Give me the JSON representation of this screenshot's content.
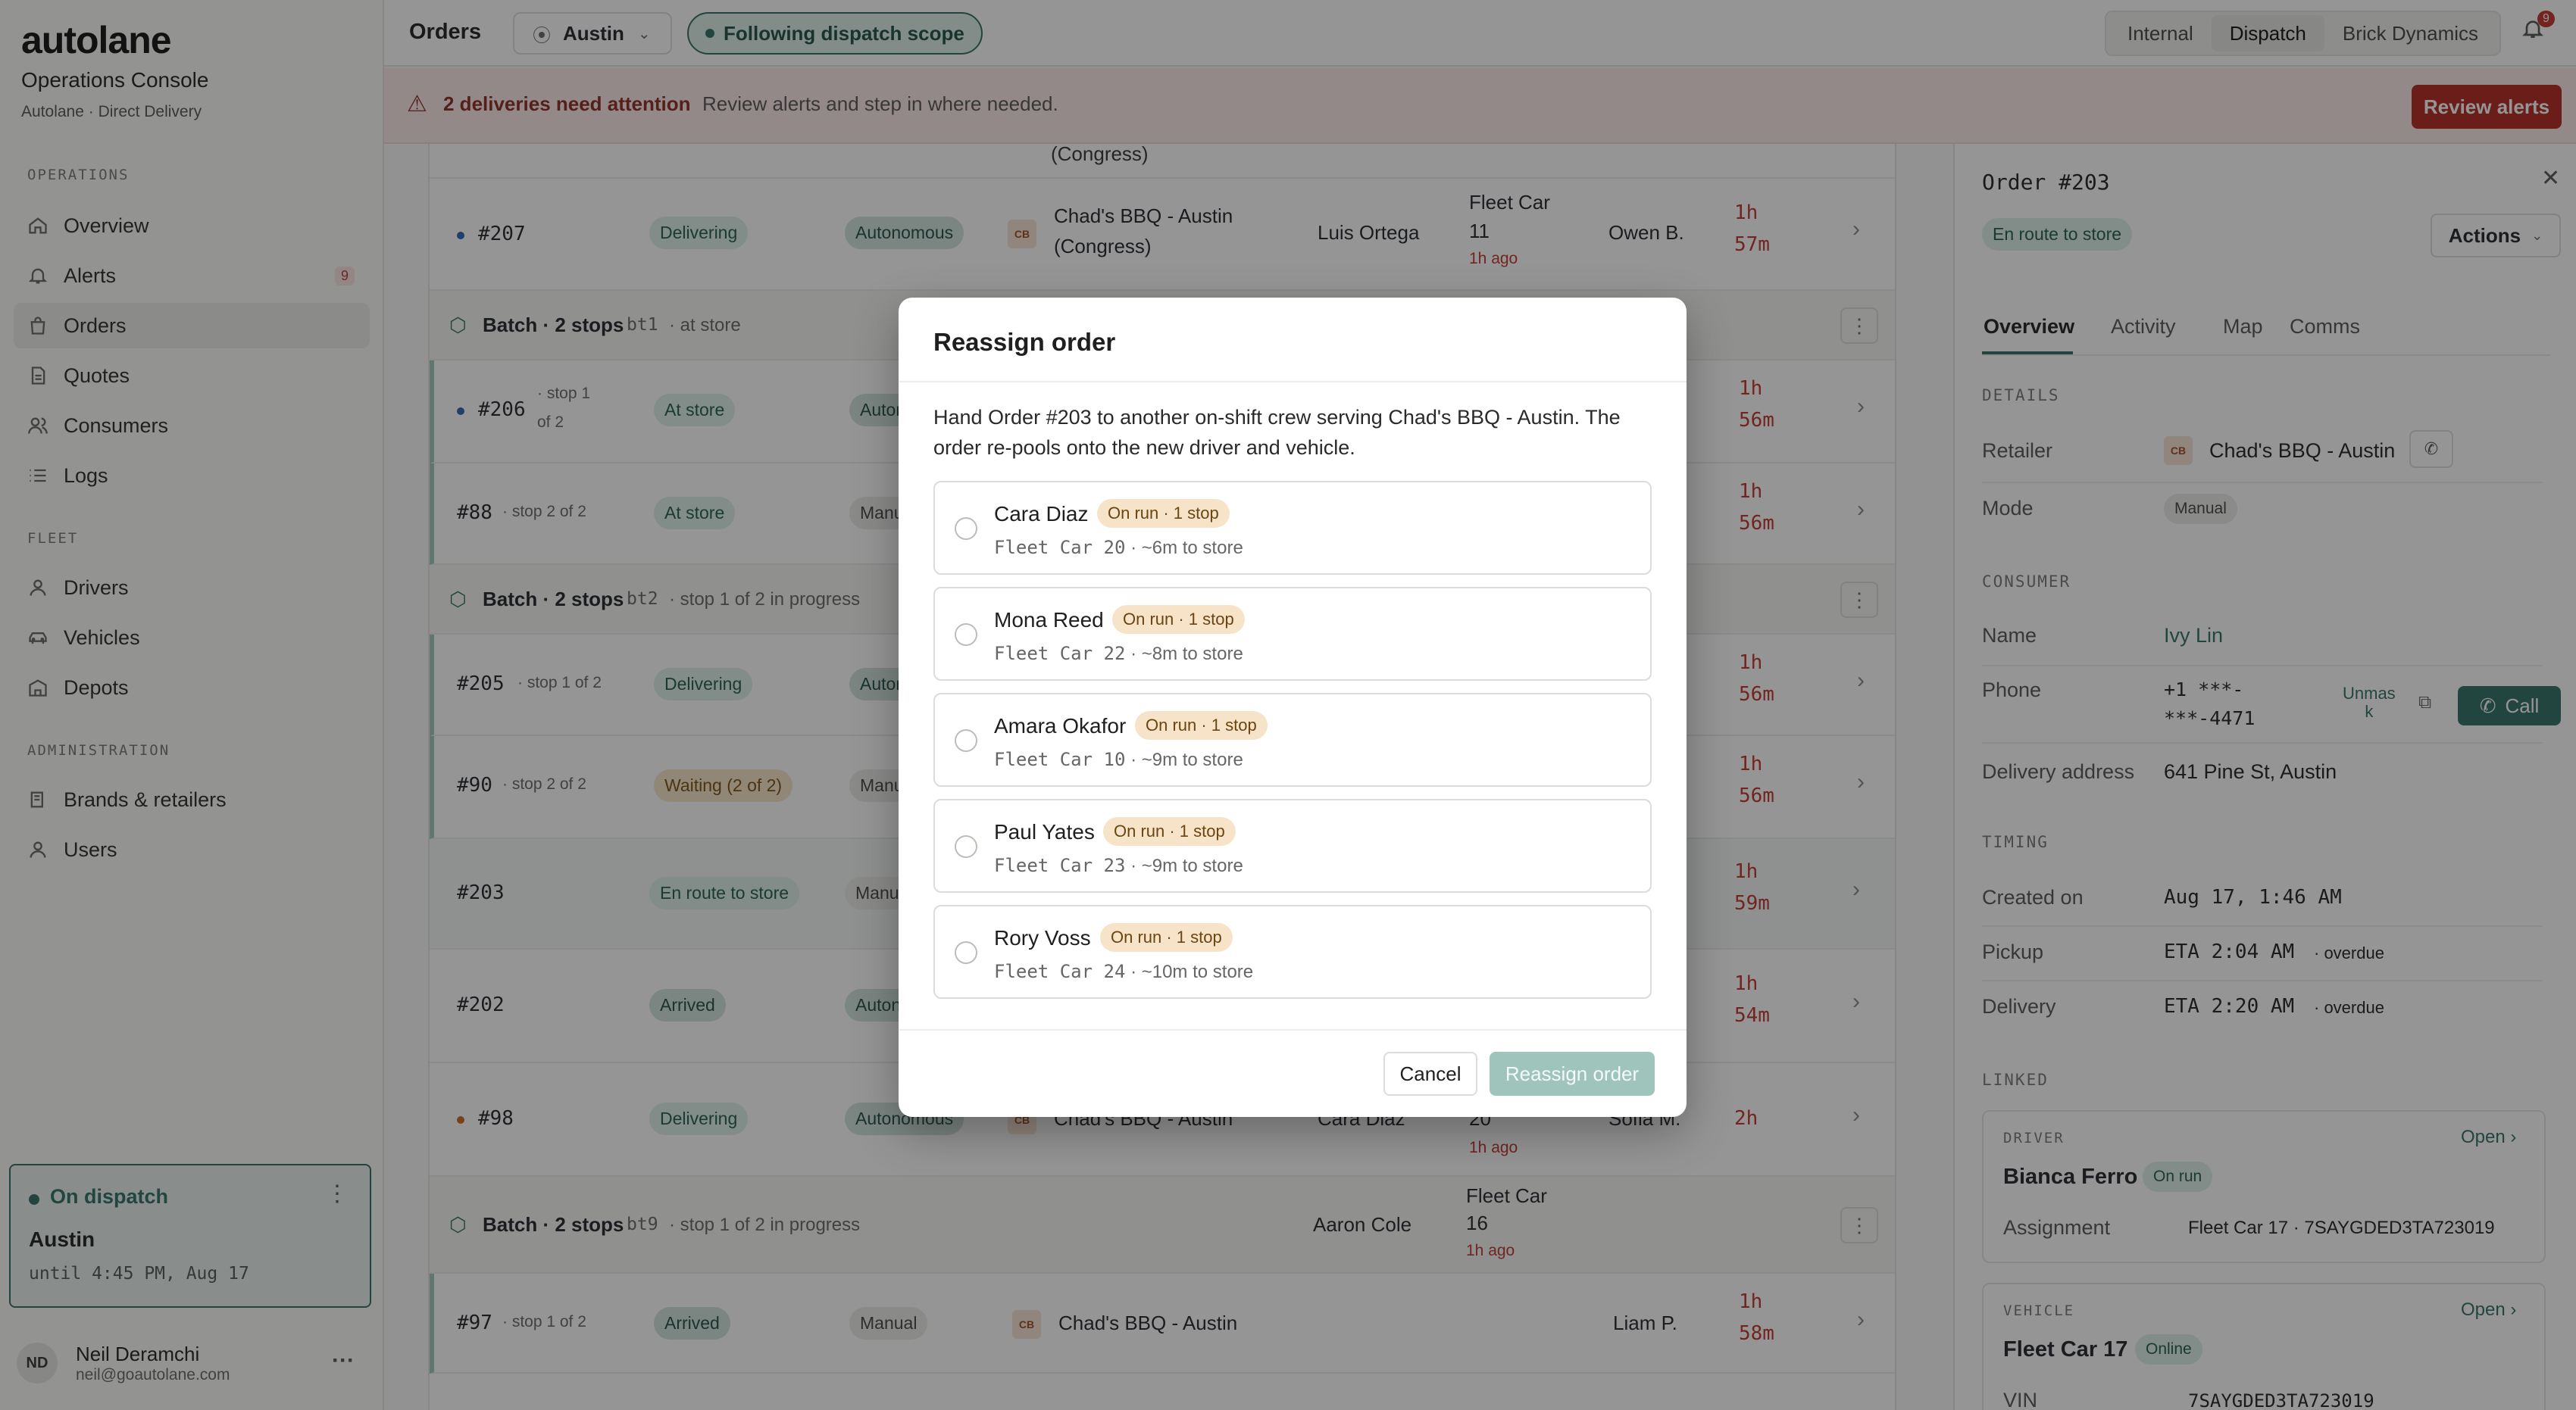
{
  "brand": {
    "logo": "autolane",
    "title": "Operations Console",
    "subtitle": "Autolane · Direct Delivery"
  },
  "sidebar": {
    "sections": [
      {
        "label": "OPERATIONS",
        "items": [
          {
            "label": "Overview",
            "icon": "home-icon"
          },
          {
            "label": "Alerts",
            "icon": "bell-icon",
            "badge": "9"
          },
          {
            "label": "Orders",
            "icon": "bag-icon",
            "active": true
          },
          {
            "label": "Quotes",
            "icon": "document-icon"
          },
          {
            "label": "Consumers",
            "icon": "users-icon"
          },
          {
            "label": "Logs",
            "icon": "list-icon"
          }
        ]
      },
      {
        "label": "FLEET",
        "items": [
          {
            "label": "Drivers",
            "icon": "person-icon"
          },
          {
            "label": "Vehicles",
            "icon": "car-icon"
          },
          {
            "label": "Depots",
            "icon": "building-icon"
          }
        ]
      },
      {
        "label": "ADMINISTRATION",
        "items": [
          {
            "label": "Brands & retailers",
            "icon": "book-icon"
          },
          {
            "label": "Users",
            "icon": "person-icon"
          }
        ]
      }
    ],
    "dispatch": {
      "status": "On dispatch",
      "city": "Austin",
      "until": "until 4:45 PM, Aug 17"
    },
    "user": {
      "initials": "ND",
      "name": "Neil Deramchi",
      "email": "neil@goautolane.com",
      "more": "···"
    }
  },
  "topbar": {
    "title": "Orders",
    "city": "Austin",
    "scope": "Following dispatch scope",
    "tabs": [
      "Internal",
      "Dispatch",
      "Brick Dynamics"
    ],
    "active_tab": "Dispatch",
    "notif_count": "9"
  },
  "banner": {
    "title": "2 deliveries need attention",
    "text": "Review alerts and step in where needed.",
    "button": "Review alerts"
  },
  "orders": {
    "top_partial": "(Congress)",
    "rows": [
      {
        "id": "#207",
        "status": "Delivering",
        "mode": "Autonomous",
        "retailer": "Chad's BBQ - Austin",
        "retailer2": "(Congress)",
        "driver": "Luis Ortega",
        "vehicle": "Fleet Car",
        "vehicle2": "11",
        "vehicle_ago": "1h ago",
        "customer": "Owen B.",
        "age1": "1h",
        "age2": "57m"
      },
      {
        "batch": "Batch · 2 stops",
        "code": "bt1",
        "note": "· at store"
      },
      {
        "id": "#206",
        "stop": "· stop 1",
        "stop2": "of 2",
        "status": "At store",
        "mode": "Autonomous",
        "age1": "1h",
        "age2": "56m"
      },
      {
        "id": "#88",
        "stop": "· stop 2 of 2",
        "status": "At store",
        "mode": "Manual",
        "age1": "1h",
        "age2": "56m"
      },
      {
        "batch": "Batch · 2 stops",
        "code": "bt2",
        "note": "· stop 1 of 2 in progress"
      },
      {
        "id": "#205",
        "stop": "· stop 1 of 2",
        "status": "Delivering",
        "mode": "Autonomous",
        "age1": "1h",
        "age2": "56m"
      },
      {
        "id": "#90",
        "stop": "· stop 2 of 2",
        "status": "Waiting (2 of 2)",
        "mode": "Manual",
        "age1": "1h",
        "age2": "56m"
      },
      {
        "id": "#203",
        "status": "En route to store",
        "mode": "Manual",
        "age1": "1h",
        "age2": "59m"
      },
      {
        "id": "#202",
        "status": "Arrived",
        "mode": "Autonomous",
        "age1": "1h",
        "age2": "54m"
      },
      {
        "id": "#98",
        "status": "Delivering",
        "mode": "Autonomous",
        "retailer": "Chad's BBQ - Austin",
        "driver": "Cara Diaz",
        "vehicle": "20",
        "vehicle_ago": "1h ago",
        "customer": "Sofia M.",
        "age1": "2h"
      },
      {
        "batch": "Batch · 2 stops",
        "code": "bt9",
        "note": "· stop 1 of 2 in progress",
        "driver": "Aaron Cole",
        "vehicle": "Fleet Car",
        "vehicle2": "16",
        "vehicle_ago": "1h ago"
      },
      {
        "id": "#97",
        "stop": "· stop 1 of 2",
        "status": "Arrived",
        "mode": "Manual",
        "retailer": "Chad's BBQ - Austin",
        "customer": "Liam P.",
        "age1": "1h",
        "age2": "58m"
      }
    ]
  },
  "panel": {
    "title": "Order #203",
    "status": "En route to store",
    "actions": "Actions",
    "tabs": [
      "Overview",
      "Activity",
      "Map",
      "Comms"
    ],
    "details_label": "DETAILS",
    "retailer_label": "Retailer",
    "retailer_logo": "CB",
    "retailer": "Chad's BBQ - Austin",
    "mode_label": "Mode",
    "mode": "Manual",
    "consumer_label": "CONSUMER",
    "name_label": "Name",
    "name": "Ivy Lin",
    "phone_label": "Phone",
    "phone1": "+1 ***-",
    "phone2": "***-4471",
    "unmask1": "Unmas",
    "unmask2": "k",
    "call": "Call",
    "address_label": "Delivery address",
    "address": "641 Pine St, Austin",
    "timing_label": "TIMING",
    "created_label": "Created on",
    "created": "Aug 17, 1:46 AM",
    "pickup_label": "Pickup",
    "pickup": "ETA 2:04 AM",
    "delivery_label": "Delivery",
    "delivery": "ETA 2:20 AM",
    "overdue": "· overdue",
    "linked_label": "LINKED",
    "driver_card": {
      "label": "DRIVER",
      "open": "Open",
      "name": "Bianca Ferro",
      "status": "On run",
      "assign_label": "Assignment",
      "assign": "Fleet Car 17 · 7SAYGDED3TA723019"
    },
    "vehicle_card": {
      "label": "VEHICLE",
      "open": "Open",
      "name": "Fleet Car 17",
      "status": "Online",
      "vin_label": "VIN",
      "vin": "7SAYGDED3TA723019"
    }
  },
  "modal": {
    "title": "Reassign order",
    "description": "Hand Order #203 to another on-shift crew serving Chad's BBQ - Austin. The order re-pools onto the new driver and vehicle.",
    "options": [
      {
        "name": "Cara Diaz",
        "badge": "On run · 1 stop",
        "car": "Fleet Car 20",
        "dist": "· ~6m to store"
      },
      {
        "name": "Mona Reed",
        "badge": "On run · 1 stop",
        "car": "Fleet Car 22",
        "dist": "· ~8m to store"
      },
      {
        "name": "Amara Okafor",
        "badge": "On run · 1 stop",
        "car": "Fleet Car 10",
        "dist": "· ~9m to store"
      },
      {
        "name": "Paul Yates",
        "badge": "On run · 1 stop",
        "car": "Fleet Car 23",
        "dist": "· ~9m to store"
      },
      {
        "name": "Rory Voss",
        "badge": "On run · 1 stop",
        "car": "Fleet Car 24",
        "dist": "· ~10m to store"
      }
    ],
    "cancel": "Cancel",
    "confirm": "Reassign order"
  }
}
